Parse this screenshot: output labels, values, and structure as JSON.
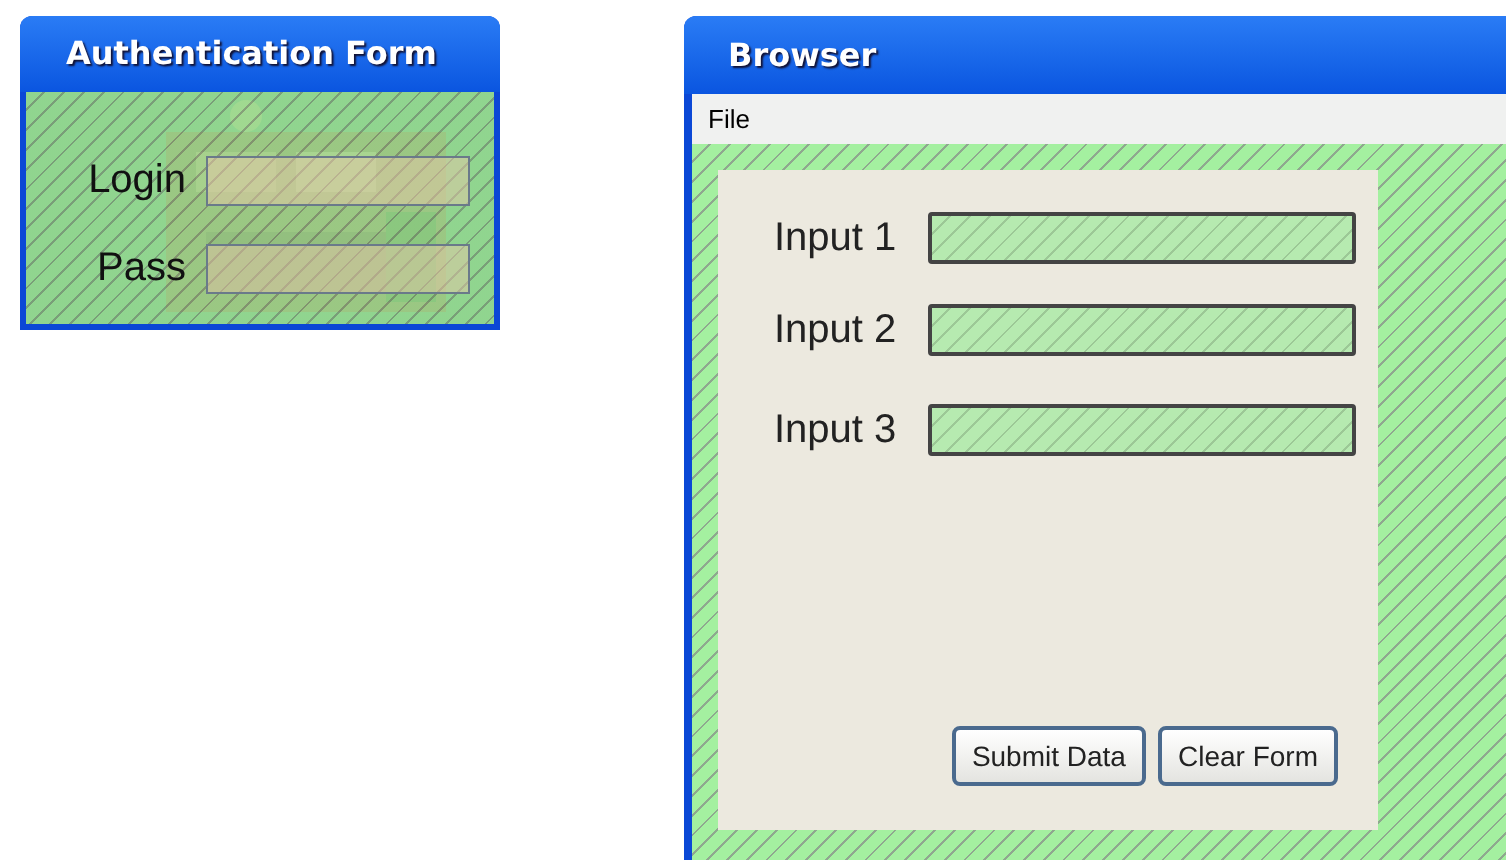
{
  "auth_window": {
    "title": "Authentication Form",
    "fields": [
      {
        "label": "Login"
      },
      {
        "label": "Pass"
      }
    ]
  },
  "browser_window": {
    "title": "Browser",
    "menu": [
      "File"
    ],
    "fields": [
      {
        "label": "Input 1"
      },
      {
        "label": "Input 2"
      },
      {
        "label": "Input 3"
      }
    ],
    "buttons": [
      "Submit Data",
      "Clear Form"
    ]
  }
}
